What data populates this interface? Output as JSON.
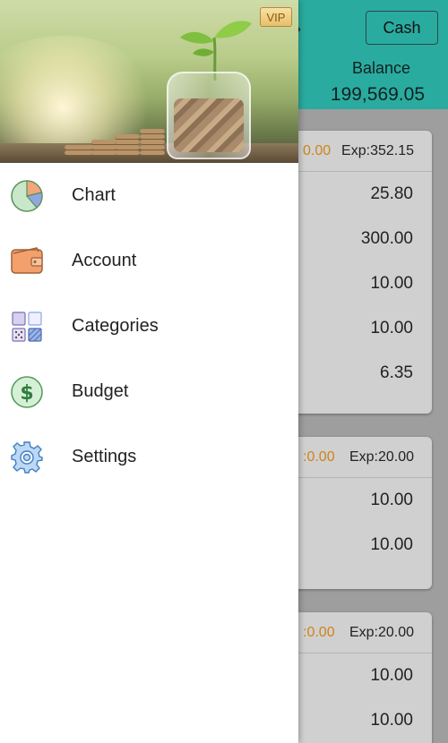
{
  "header": {
    "cash_label": "Cash",
    "balance_label": "Balance",
    "balance_value": "199,569.05",
    "vip_badge": "VIP"
  },
  "cards": [
    {
      "income_partial": "0.00",
      "expense_label": "Exp:",
      "expense_value": "352.15",
      "rows": [
        "25.80",
        "300.00",
        "10.00",
        "10.00",
        "6.35"
      ]
    },
    {
      "income_partial": ":0.00",
      "expense_label": "Exp:",
      "expense_value": "20.00",
      "rows": [
        "10.00",
        "10.00"
      ]
    },
    {
      "income_partial": ":0.00",
      "expense_label": "Exp:",
      "expense_value": "20.00",
      "rows": [
        "10.00",
        "10.00"
      ]
    }
  ],
  "drawer": {
    "items": [
      {
        "label": "Chart",
        "icon": "pie-chart-icon"
      },
      {
        "label": "Account",
        "icon": "wallet-icon"
      },
      {
        "label": "Categories",
        "icon": "categories-icon"
      },
      {
        "label": "Budget",
        "icon": "dollar-icon"
      },
      {
        "label": "Settings",
        "icon": "gear-icon"
      }
    ]
  },
  "colors": {
    "header_teal": "#2aaba0",
    "income_orange": "#d0831a",
    "overlay_gray": "#9e9e9e"
  }
}
